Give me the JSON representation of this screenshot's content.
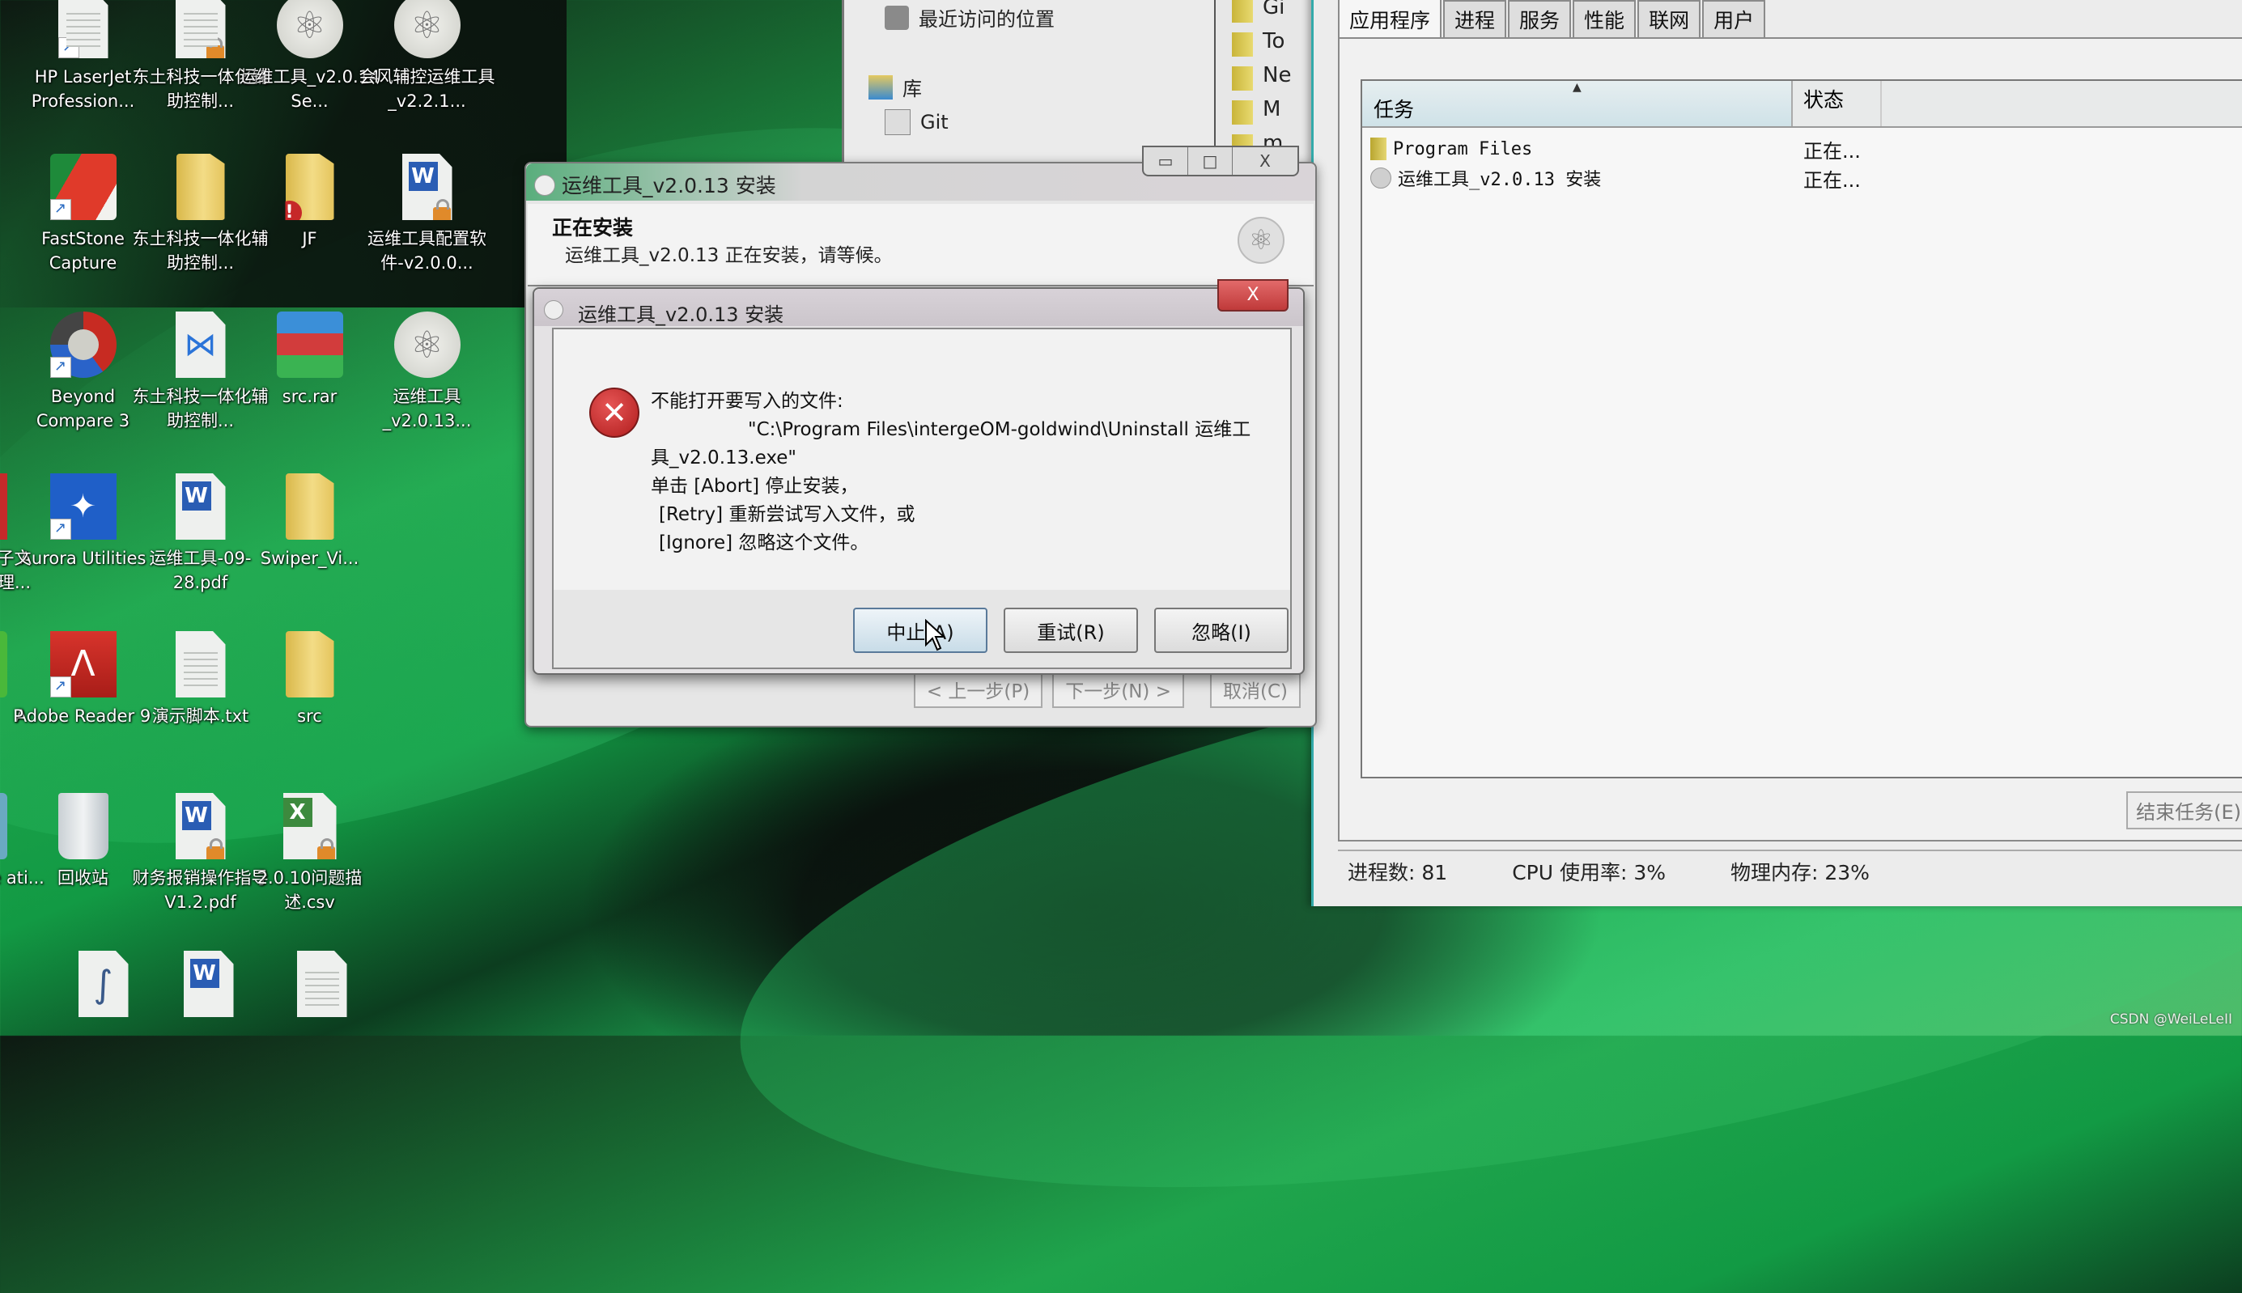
{
  "desktop": {
    "icons": [
      {
        "label": "HP LaserJet Profession...",
        "icon": "printer-shortcut-icon"
      },
      {
        "label": "东土科技一体化辅助控制...",
        "icon": "locked-document-icon"
      },
      {
        "label": "运维工具_v2.0.14 Se...",
        "icon": "app-disc-icon"
      },
      {
        "label": "会风辅控运维工具_v2.2.1...",
        "icon": "app-disc-icon"
      },
      {
        "label": "FastStone Capture",
        "icon": "faststone-icon"
      },
      {
        "label": "东土科技一体化辅助控制...",
        "icon": "folder-icon"
      },
      {
        "label": "JF",
        "icon": "folder-warning-icon"
      },
      {
        "label": "运维工具配置软件-v2.0.0...",
        "icon": "locked-word-icon"
      },
      {
        "label": "Beyond Compare 3",
        "icon": "beyond-compare-icon"
      },
      {
        "label": "东土科技一体化辅助控制...",
        "icon": "vscode-file-icon"
      },
      {
        "label": "src.rar",
        "icon": "winrar-icon"
      },
      {
        "label": "运维工具_v2.0.13...",
        "icon": "app-disc-icon"
      },
      {
        "label": "Aurora Utilities",
        "icon": "aurora-icon"
      },
      {
        "label": "运维工具-09-28.pdf",
        "icon": "wps-pdf-icon"
      },
      {
        "label": "Swiper_Vi...",
        "icon": "folder-icon"
      },
      {
        "label": "Adobe Reader 9",
        "icon": "adobe-reader-icon"
      },
      {
        "label": "演示脚本.txt",
        "icon": "text-file-icon"
      },
      {
        "label": "src",
        "icon": "folder-icon"
      },
      {
        "label": "回收站",
        "icon": "recycle-bin-icon"
      },
      {
        "label": "财务报销操作指导V1.2.pdf",
        "icon": "locked-word-icon"
      },
      {
        "label": "2.0.10问题描述.csv",
        "icon": "locked-excel-icon"
      }
    ],
    "partial_left_labels": [
      "子文理...",
      "P",
      "re ati..."
    ],
    "watermark": "CSDN @WeiLeLeII"
  },
  "explorer": {
    "nav_items": [
      {
        "label": "最近访问的位置",
        "icon": "recent-places-icon"
      },
      {
        "label": "库",
        "icon": "library-icon"
      },
      {
        "label": "Git",
        "icon": "git-file-icon"
      }
    ],
    "folders_partial": [
      "Gi",
      "To",
      "Ne",
      "M",
      "m"
    ]
  },
  "task_manager": {
    "tabs": [
      "应用程序",
      "进程",
      "服务",
      "性能",
      "联网",
      "用户"
    ],
    "active_tab": "应用程序",
    "columns": {
      "task": "任务",
      "status": "状态"
    },
    "rows": [
      {
        "task": "Program Files",
        "status": "正在...",
        "icon": "folder-icon"
      },
      {
        "task": "运维工具_v2.0.13 安装",
        "status": "正在...",
        "icon": "installer-icon"
      }
    ],
    "end_task_button": "结束任务(E)",
    "status_bar": {
      "processes": "进程数: 81",
      "cpu": "CPU 使用率: 3%",
      "memory": "物理内存: 23%"
    }
  },
  "installer": {
    "title": "运维工具_v2.0.13 安装",
    "header_title": "正在安装",
    "header_subtitle": "运维工具_v2.0.13 正在安装，请等候。",
    "window_controls": {
      "minimize": "▭",
      "maximize": "□",
      "close": "X"
    },
    "nav_buttons": {
      "back": "< 上一步(P)",
      "next": "下一步(N) >",
      "cancel": "取消(C)"
    }
  },
  "error_dialog": {
    "title": "运维工具_v2.0.13 安装",
    "close": "X",
    "message_line1": "不能打开要写入的文件:",
    "message_path": "\"C:\\Program Files\\intergeOM-goldwind\\Uninstall 运维工",
    "message_path_cont": "具_v2.0.13.exe\"",
    "message_abort": "单击 [Abort] 停止安装，",
    "message_retry": "[Retry] 重新尝试写入文件，或",
    "message_ignore": "[Ignore] 忽略这个文件。",
    "buttons": {
      "abort": "中止(A)",
      "retry": "重试(R)",
      "ignore": "忽略(I)"
    },
    "focused_button": "abort",
    "error_color": "#c62828"
  }
}
